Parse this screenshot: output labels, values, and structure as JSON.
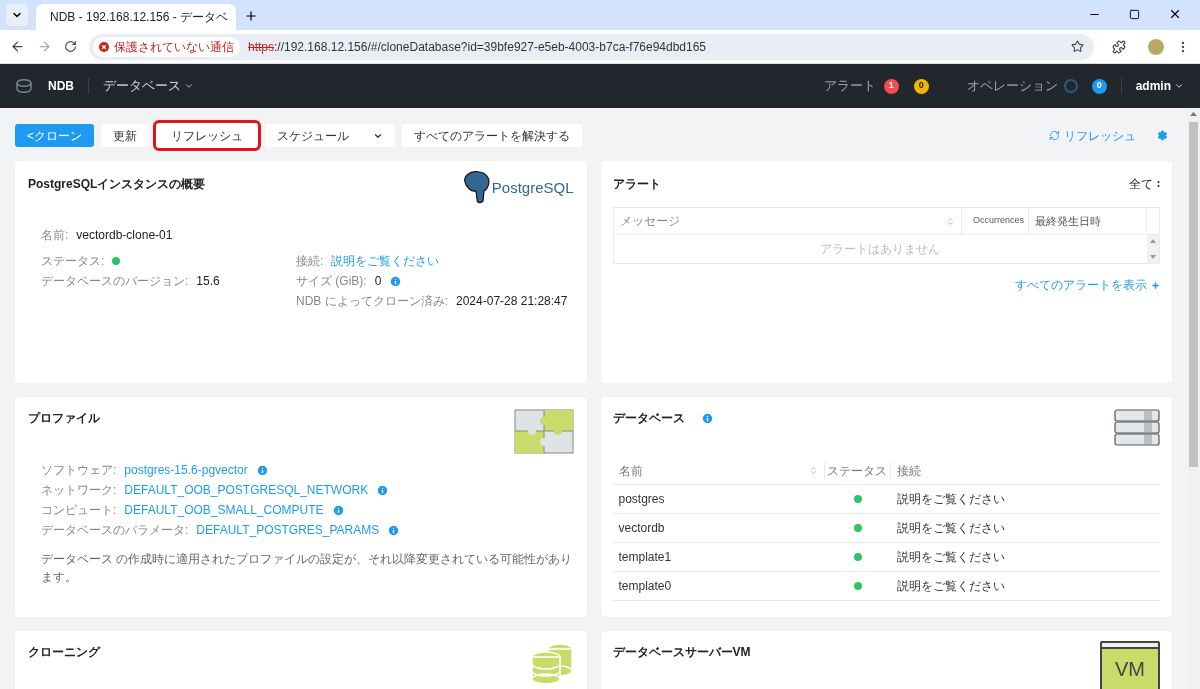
{
  "browser": {
    "tab_title": "NDB - 192.168.12.156 - データベ",
    "security_label": "保護されていない通信",
    "url_scheme": "https",
    "url_rest": "://192.168.12.156/#/cloneDatabase?id=39bfe927-e5eb-4003-b7ca-f76e94dbd165"
  },
  "header": {
    "brand": "NDB",
    "menu": "データベース",
    "alerts_label": "アラート",
    "alert_badges": [
      {
        "count": "1",
        "color": "#ef4f4f"
      },
      {
        "count": "0",
        "color": "#f5b400"
      }
    ],
    "operations_label": "オペレーション",
    "operations_badge": {
      "count": "0",
      "color": "#1e9bf0"
    },
    "user": "admin"
  },
  "toolbar": {
    "buttons": [
      {
        "label": "<クローン",
        "kind": "primary",
        "highlighted": false
      },
      {
        "label": "更新",
        "kind": "plain",
        "highlighted": false
      },
      {
        "label": "リフレッシュ",
        "kind": "plain",
        "highlighted": true
      },
      {
        "label": "スケジュール",
        "kind": "dropdown",
        "highlighted": false
      },
      {
        "label": "すべてのアラートを解決する",
        "kind": "plain",
        "highlighted": false
      }
    ],
    "refresh_link": "リフレッシュ"
  },
  "overview": {
    "title": "PostgreSQLインスタンスの概要",
    "logo_text": "PostgreSQL",
    "name": {
      "label": "名前:",
      "value": "vectordb-clone-01"
    },
    "left_fields": [
      {
        "label": "ステータス:",
        "kind": "status",
        "color": "#2fc463"
      },
      {
        "label": "データベースのバージョン:",
        "kind": "text",
        "value": "15.6"
      }
    ],
    "right_fields": [
      {
        "label": "接続:",
        "kind": "link",
        "value": "説明をご覧ください"
      },
      {
        "label": "サイズ (GiB):",
        "kind": "text",
        "value": "0",
        "info": true
      },
      {
        "label": "NDB によってクローン済み:",
        "kind": "text",
        "value": "2024-07-28 21:28:47"
      }
    ]
  },
  "alerts": {
    "title": "アラート",
    "filter": "全て",
    "columns": [
      "メッセージ",
      "Occurrences",
      "最終発生日時"
    ],
    "empty_text": "アラートはありません",
    "view_all": "すべてのアラートを表示"
  },
  "profile": {
    "title": "プロファイル",
    "fields": [
      {
        "label": "ソフトウェア:",
        "kind": "link",
        "value": "postgres-15.6-pgvector",
        "info": true
      },
      {
        "label": "ネットワーク:",
        "kind": "link",
        "value": "DEFAULT_OOB_POSTGRESQL_NETWORK",
        "info": true
      },
      {
        "label": "コンピュート:",
        "kind": "link",
        "value": "DEFAULT_OOB_SMALL_COMPUTE",
        "info": true
      },
      {
        "label": "データベースのパラメータ:",
        "kind": "link",
        "value": "DEFAULT_POSTGRES_PARAMS",
        "info": true
      }
    ],
    "note": "データベース の作成時に適用されたプロファイルの設定が、それ以降変更されている可能性があります。"
  },
  "databases": {
    "title": "データベース",
    "columns": [
      "名前",
      "ステータス",
      "接続"
    ],
    "rows": [
      {
        "name": "postgres",
        "color": "#2fc463",
        "connection": "説明をご覧ください"
      },
      {
        "name": "vectordb",
        "color": "#2fc463",
        "connection": "説明をご覧ください"
      },
      {
        "name": "template1",
        "color": "#2fc463",
        "connection": "説明をご覧ください"
      },
      {
        "name": "template0",
        "color": "#2fc463",
        "connection": "説明をご覧ください"
      }
    ]
  },
  "cloning": {
    "title": "クローニング"
  },
  "server_vm": {
    "title": "データベースサーバーVM",
    "icon_text": "VM"
  }
}
